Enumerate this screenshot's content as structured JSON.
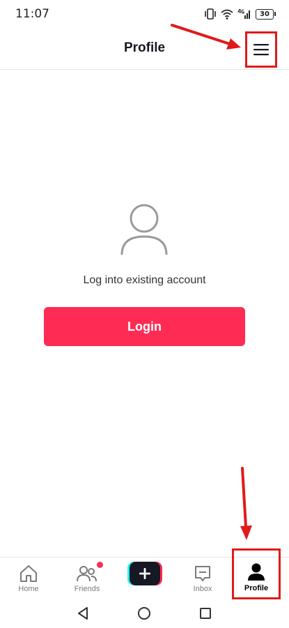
{
  "status_bar": {
    "time": "11:07",
    "battery": "30"
  },
  "header": {
    "title": "Profile",
    "menu_icon": "hamburger-menu-icon"
  },
  "login": {
    "avatar_icon": "person-outline-icon",
    "caption": "Log into existing account",
    "button_label": "Login"
  },
  "tab_bar": {
    "tabs": [
      {
        "label": "Home",
        "icon": "home-icon"
      },
      {
        "label": "Friends",
        "icon": "friends-icon"
      },
      {
        "label": "",
        "icon": "plus-icon"
      },
      {
        "label": "Inbox",
        "icon": "inbox-icon"
      },
      {
        "label": "Profile",
        "icon": "person-filled-icon",
        "selected": true
      }
    ]
  },
  "nav_bar": {
    "icons": [
      "back-triangle-icon",
      "home-circle-icon",
      "recents-square-icon"
    ]
  },
  "colors": {
    "accent": "#fe2c55",
    "annotation": "#e01a1a",
    "text": "#161823",
    "muted": "#7a7a7a",
    "cyan": "#25f4ee"
  }
}
